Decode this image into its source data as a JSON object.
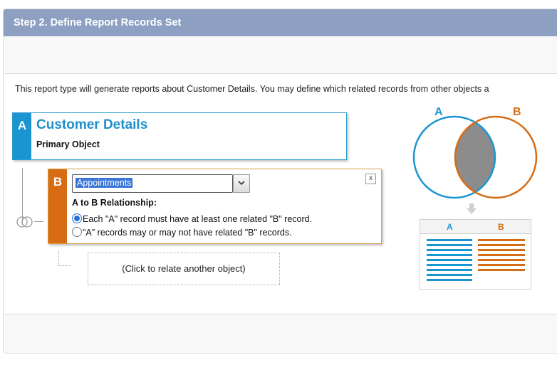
{
  "header": {
    "title": "Step 2. Define Report Records Set"
  },
  "description": "This report type will generate reports about Customer Details. You may define which related records from other objects a",
  "object_a": {
    "letter": "A",
    "name": "Customer Details",
    "role": "Primary Object"
  },
  "object_b": {
    "letter": "B",
    "selected": "Appointments",
    "close_label": "x",
    "relationship_label": "A to B Relationship:",
    "options": [
      {
        "text": "Each \"A\" record must have at least one related \"B\" record.",
        "checked": true
      },
      {
        "text": "\"A\" records may or may not have related \"B\" records.",
        "checked": false
      }
    ]
  },
  "add_object": {
    "label": "(Click to relate another object)"
  },
  "venn": {
    "label_a": "A",
    "label_b": "B"
  },
  "result_table": {
    "col_a": "A",
    "col_b": "B"
  },
  "colors": {
    "header": "#8ea0c2",
    "a_blue": "#1b95d2",
    "b_orange": "#d76c14",
    "overlap": "#8c8c8c"
  },
  "icons": {
    "dropdown": "chevron-down-icon",
    "arrow": "arrow-down-icon",
    "rings": "join-rings-icon"
  }
}
